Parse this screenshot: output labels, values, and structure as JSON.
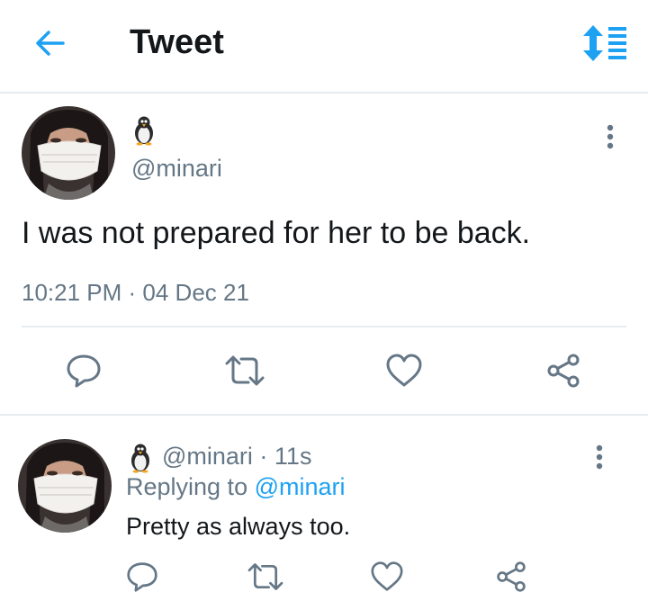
{
  "header": {
    "title": "Tweet",
    "back_icon": "arrow-left-icon",
    "sort_icon": "sort-list-icon",
    "accent_color": "#1da1f2"
  },
  "main_tweet": {
    "display_name_icon": "penguin-emoji",
    "handle": "@minari",
    "text": "I was not prepared for her to be back.",
    "timestamp": "10:21 PM · 04 Dec 21",
    "actions": [
      "reply-icon",
      "retweet-icon",
      "like-icon",
      "share-icon"
    ]
  },
  "reply": {
    "display_name_icon": "penguin-emoji",
    "handle_time": "@minari · 11s",
    "replying_prefix": "Replying to",
    "replying_handle": "@minari",
    "text": "Pretty as always too.",
    "actions": [
      "reply-icon",
      "retweet-icon",
      "like-icon",
      "share-icon"
    ]
  },
  "colors": {
    "text_primary": "#14171a",
    "text_secondary": "#657786",
    "icon_gray": "#657786",
    "divider": "#e6ecf0"
  }
}
